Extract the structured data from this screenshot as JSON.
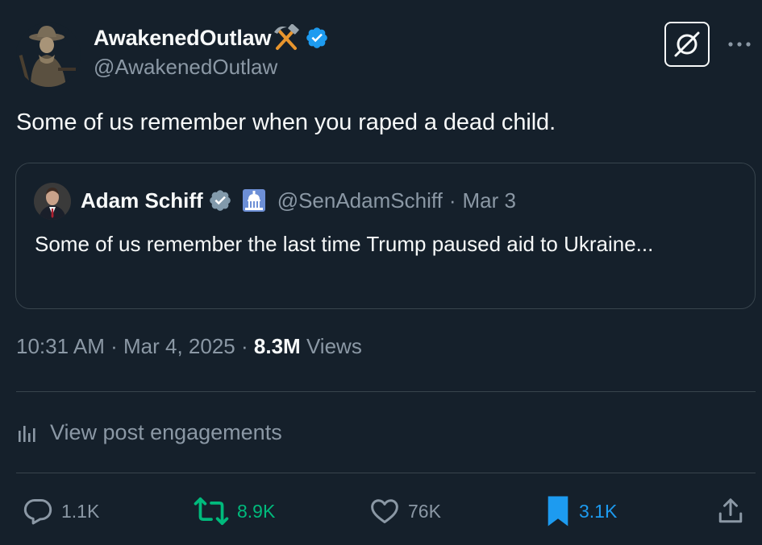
{
  "author": {
    "display_name": "AwakenedOutlaw",
    "name_emoji": "hammer-and-pick-icon",
    "handle": "@AwakenedOutlaw",
    "verified": true
  },
  "post": {
    "text": "Some of us remember when you raped a dead child."
  },
  "quoted": {
    "display_name": "Adam Schiff",
    "handle": "@SenAdamSchiff",
    "separator": "·",
    "date": "Mar 3",
    "text": "Some of us remember the last time Trump paused aid to Ukraine...",
    "affiliation_icon": "capitol-icon"
  },
  "meta": {
    "time": "10:31 AM",
    "separator": "·",
    "date": "Mar 4, 2025",
    "views_count": "8.3M",
    "views_label": "Views"
  },
  "engagements": {
    "label": "View post engagements"
  },
  "actions": {
    "replies": "1.1K",
    "reposts": "8.9K",
    "likes": "76K",
    "bookmarks": "3.1K"
  },
  "colors": {
    "background": "#15202b",
    "text_primary": "#f7f9f9",
    "text_secondary": "#8b98a5",
    "verified_blue": "#1d9bf0",
    "repost_green": "#00ba7c",
    "bookmark_blue": "#1d9bf0",
    "border": "#38444d"
  }
}
